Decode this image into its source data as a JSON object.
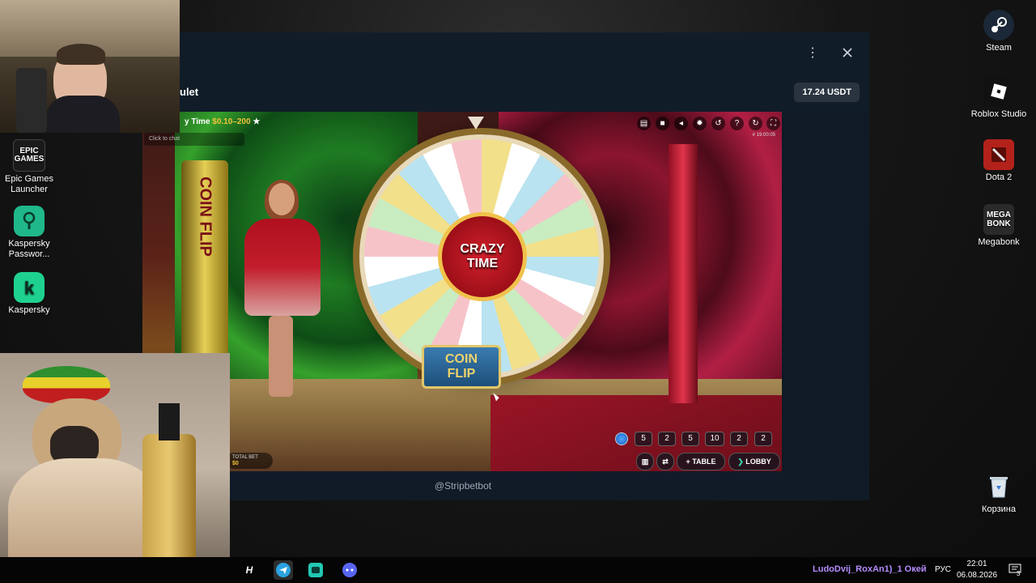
{
  "desktop": {
    "left_icons": [
      {
        "label": "Epic Games Launcher",
        "icon": "epic-games-icon",
        "text": "EPIC\nGAMES"
      },
      {
        "label": "Kaspersky Passwor...",
        "icon": "kaspersky-password-icon",
        "text": ""
      },
      {
        "label": "Kaspersky",
        "icon": "kaspersky-icon",
        "text": "k"
      }
    ],
    "right_icons": [
      {
        "label": "Steam",
        "icon": "steam-icon"
      },
      {
        "label": "Roblox Studio",
        "icon": "roblox-studio-icon"
      },
      {
        "label": "Dota 2",
        "icon": "dota2-icon"
      },
      {
        "label": "Megabonk",
        "icon": "megabonk-icon",
        "text": "MEGA\nBONK"
      },
      {
        "label": "Корзина",
        "icon": "recycle-bin-icon"
      }
    ]
  },
  "app": {
    "title_partial": "ulet",
    "balance": "17.24 USDT",
    "footer_text": "@Stripbetbot",
    "menu_icon": "more-vertical-icon",
    "close_icon": "close-icon"
  },
  "game": {
    "title_prefix": "y Time",
    "limits": "$0.10–200",
    "chat_placeholder": "Click to chat",
    "round_id": "# 19:00:05",
    "wheel_hub_line1": "CRAZY",
    "wheel_hub_line2": "TIME",
    "flip_line1": "COIN",
    "flip_line2": "FLIP",
    "pillar_text": "COIN FLIP",
    "history": [
      "5",
      "2",
      "5",
      "10",
      "2",
      "2"
    ],
    "total_bet_label": "TOTAL BET",
    "total_bet_value": "$0",
    "table_button": "TABLE",
    "lobby_button": "LOBBY",
    "hud_icons": [
      "chat-icon",
      "video-icon",
      "volume-icon",
      "settings-icon",
      "history-icon",
      "help-icon",
      "refresh-icon",
      "fullscreen-icon"
    ]
  },
  "taskbar": {
    "apps": [
      "app-h-icon",
      "telegram-icon",
      "game-app-icon",
      "discord-icon"
    ],
    "ticker": "LudoDvij_RoxAn1)_1 Окей",
    "language": "РУС",
    "time": "22:01",
    "date": "06.08.2026",
    "notifications": "3"
  }
}
